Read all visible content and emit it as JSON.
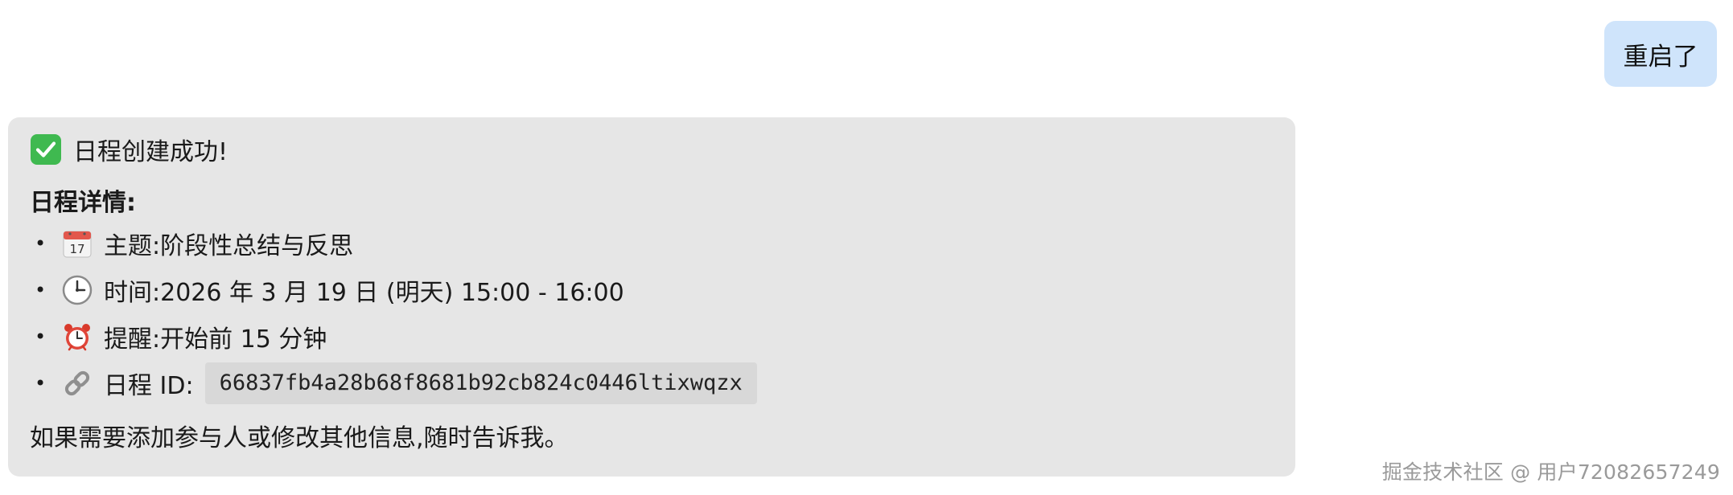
{
  "user_message": {
    "text": "重启了"
  },
  "bot_message": {
    "success_text": "日程创建成功!",
    "section_title": "日程详情:",
    "details": [
      {
        "icon": "calendar-icon",
        "label": "主题:",
        "value": "阶段性总结与反思"
      },
      {
        "icon": "clock-icon",
        "label": "时间:",
        "value": "2026 年 3 月 19 日 (明天) 15:00 - 16:00"
      },
      {
        "icon": "alarm-clock-icon",
        "label": "提醒:",
        "value": "开始前 15 分钟"
      },
      {
        "icon": "link-icon",
        "label": "日程 ID:",
        "value": "66837fb4a28b68f8681b92cb824c0446ltixwqzx"
      }
    ],
    "footer_text": "如果需要添加参与人或修改其他信息,随时告诉我。"
  },
  "watermark": "掘金技术社区 @ 用户72082657249",
  "colors": {
    "user_bubble_bg": "#cfe4fb",
    "bot_card_bg": "#e6e6e6",
    "check_green": "#3fb950"
  }
}
